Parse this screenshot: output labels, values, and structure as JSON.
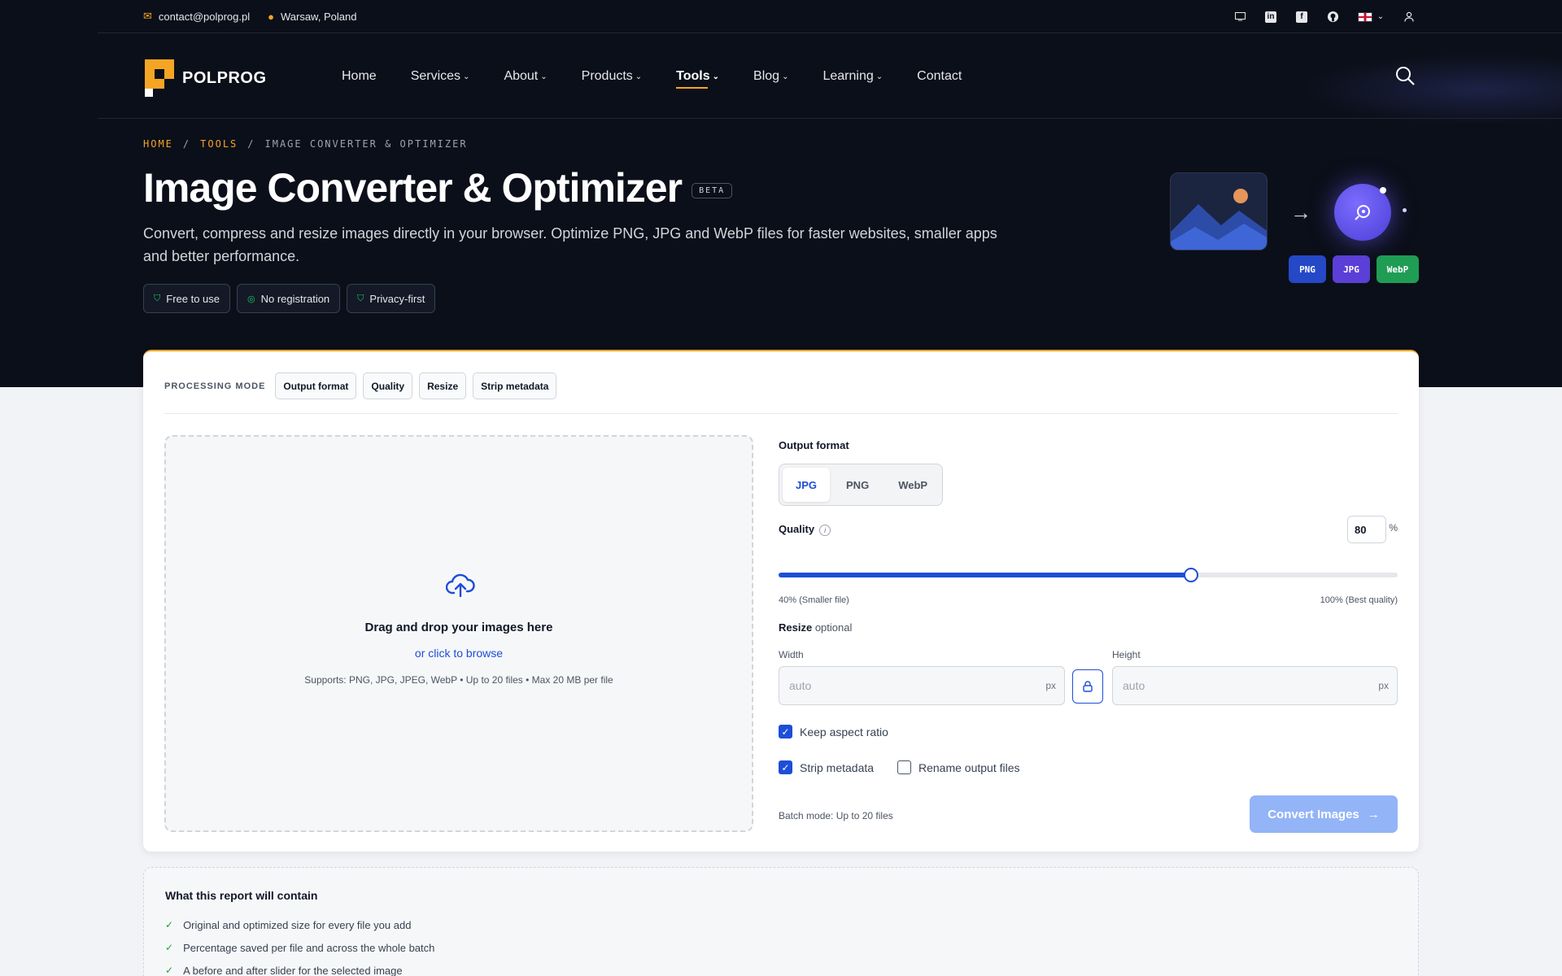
{
  "topbar": {
    "email": "contact@polprog.pl",
    "location": "Warsaw, Poland",
    "icons": [
      "monitor-icon",
      "linkedin-icon",
      "facebook-icon",
      "github-icon",
      "uk-flag-icon",
      "user-icon"
    ]
  },
  "nav": {
    "logo": "POLPROG",
    "items": [
      {
        "label": "Home",
        "has_dropdown": false
      },
      {
        "label": "Services",
        "has_dropdown": true
      },
      {
        "label": "About",
        "has_dropdown": true
      },
      {
        "label": "Products",
        "has_dropdown": true
      },
      {
        "label": "Tools",
        "has_dropdown": true,
        "active": true
      },
      {
        "label": "Blog",
        "has_dropdown": true
      },
      {
        "label": "Learning",
        "has_dropdown": true
      },
      {
        "label": "Contact",
        "has_dropdown": false
      }
    ]
  },
  "breadcrumb": [
    "HOME",
    "TOOLS",
    "IMAGE CONVERTER & OPTIMIZER"
  ],
  "hero": {
    "title": "Image Converter & Optimizer",
    "beta": "BETA",
    "subtitle": "Convert, compress and resize images directly in your browser. Optimize PNG, JPG and WebP files for faster websites, smaller apps and better performance.",
    "badges": [
      "Free to use",
      "No registration",
      "Privacy-first"
    ],
    "formats": [
      "PNG",
      "JPG",
      "WebP"
    ]
  },
  "colors": {
    "accent": "#f5a524",
    "primary": "#1d4ed8",
    "hero_bg": "#0b0f19",
    "png": "#2548c7",
    "jpg": "#5b3fd6",
    "webp": "#1f9d55"
  },
  "modes": {
    "label": "PROCESSING MODE",
    "chips": [
      "Output format",
      "Quality",
      "Resize",
      "Strip metadata"
    ]
  },
  "dropzone": {
    "heading": "Drag and drop your images here",
    "browse": "or click to browse",
    "supports": "Supports: PNG, JPG, JPEG, WebP • Up to 20 files • Max 20 MB per file"
  },
  "options": {
    "output_label": "Output format",
    "formats": [
      "JPG",
      "PNG",
      "WebP"
    ],
    "selected_format": "JPG",
    "quality_label": "Quality",
    "quality_info": "i",
    "quality_value": "80",
    "quality_unit": "%",
    "quality_min": 40,
    "quality_max": 100,
    "quality_num": 80,
    "range_low": "40% (Smaller file)",
    "range_high": "100% (Best quality)",
    "resize_label": "Resize",
    "resize_optional": "optional",
    "width_label": "Width",
    "height_label": "Height",
    "width_placeholder": "auto",
    "height_placeholder": "auto",
    "unit": "px",
    "keep_aspect": "Keep aspect ratio",
    "strip_metadata": "Strip metadata",
    "rename_output": "Rename output files",
    "batch": "Batch mode: Up to 20 files",
    "convert": "Convert Images"
  },
  "report": {
    "title": "What this report will contain",
    "items": [
      "Original and optimized size for every file you add",
      "Percentage saved per file and across the whole batch",
      "A before and after slider for the selected image"
    ]
  }
}
